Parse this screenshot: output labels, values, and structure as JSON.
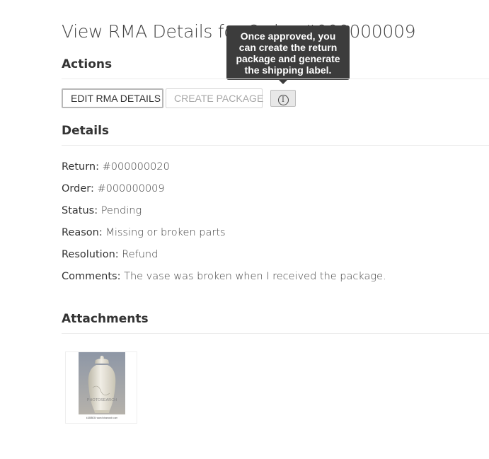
{
  "header": {
    "title": "View RMA Details for Order #000000009"
  },
  "actions": {
    "heading": "Actions",
    "edit_label": "EDIT RMA DETAILS",
    "create_package_label": "CREATE PACKAGE",
    "info_icon": "info-circle-icon",
    "tooltip": "Once approved, you can create the return package and generate the shipping label."
  },
  "details": {
    "heading": "Details",
    "rows": [
      {
        "label": "Return:",
        "value": "#000000020"
      },
      {
        "label": "Order:",
        "value": "#000000009"
      },
      {
        "label": "Status:",
        "value": "Pending"
      },
      {
        "label": "Reason:",
        "value": "Missing or broken parts"
      },
      {
        "label": "Resolution:",
        "value": "Refund"
      },
      {
        "label": "Comments:",
        "value": "The vase was broken when I received the package."
      }
    ]
  },
  "attachments": {
    "heading": "Attachments",
    "items": [
      {
        "watermark": "PHOTOSEARCH",
        "caption": "k1888034 www.fotosearch.com"
      }
    ]
  },
  "colors": {
    "tooltip_bg": "#3c3c3c",
    "rule": "#ececec",
    "disabled_text": "#a8a8a8"
  }
}
